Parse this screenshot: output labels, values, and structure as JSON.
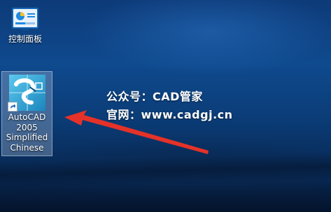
{
  "desktop": {
    "icons": [
      {
        "label": "控制面板",
        "icon": "control-panel-icon"
      },
      {
        "label": "AutoCAD 2005 Simplified Chinese",
        "label_lines": [
          "AutoCAD",
          "2005",
          "Simplified",
          "Chinese"
        ],
        "icon": "autocad-icon",
        "shortcut_badge": "shortcut-arrow-icon",
        "selected": true
      }
    ]
  },
  "watermark": {
    "line1": "公众号：CAD管家",
    "line2": "官网：www.cadgj.cn"
  },
  "annotation": {
    "type": "arrow",
    "color": "#e53228",
    "points_to": "autocad-icon"
  },
  "colors": {
    "wallpaper": "#0f4a8e",
    "arrow": "#e53228",
    "selection": "#a0b4cd"
  }
}
